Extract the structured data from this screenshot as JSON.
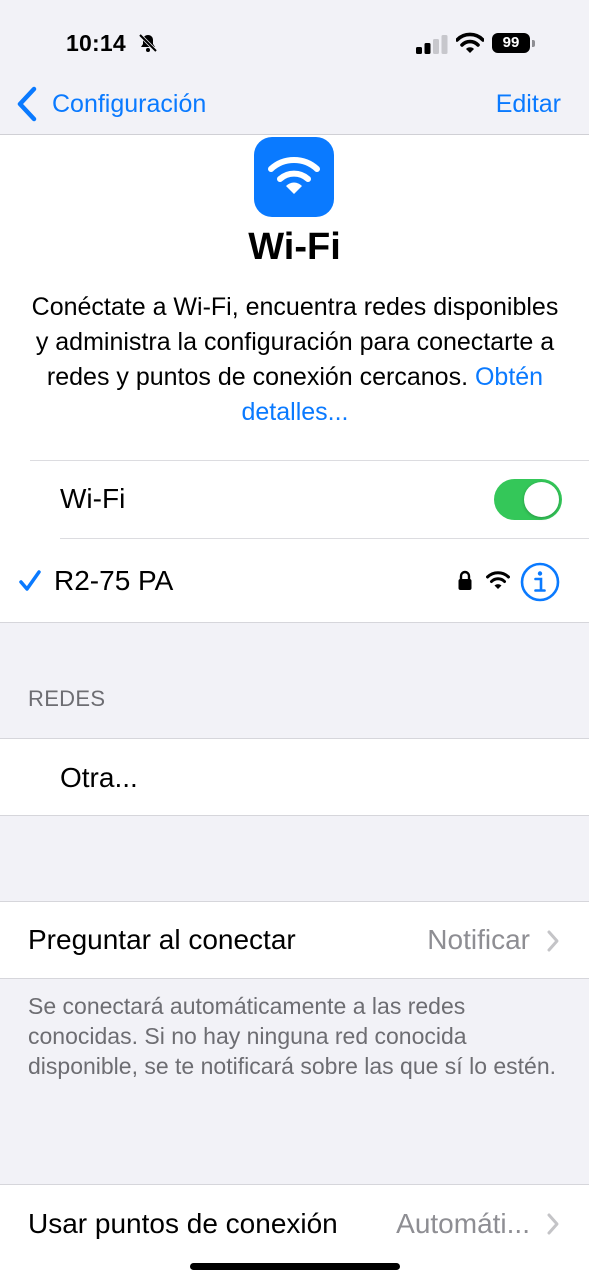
{
  "status_bar": {
    "time": "10:14",
    "battery": "99"
  },
  "nav": {
    "back_label": "Configuración",
    "edit_label": "Editar"
  },
  "header": {
    "title": "Wi-Fi",
    "description": "Conéctate a Wi-Fi, encuentra redes disponibles y administra la configuración para conectarte a redes y puntos de conexión cercanos.",
    "link": "Obtén detalles..."
  },
  "wifi_toggle": {
    "label": "Wi-Fi",
    "on": true
  },
  "connected_network": {
    "name": "R2-75 PA"
  },
  "networks_section": {
    "header": "REDES",
    "other_label": "Otra..."
  },
  "ask_to_join": {
    "label": "Preguntar al conectar",
    "value": "Notificar",
    "footer": "Se conectará automáticamente a las redes conocidas. Si no hay ninguna red conocida disponible, se te notificará sobre las que sí lo estén."
  },
  "hotspot": {
    "label": "Usar puntos de conexión",
    "value": "Automáti..."
  },
  "colors": {
    "accent": "#0a7aff",
    "toggle_on": "#34c759",
    "background": "#f2f2f7"
  }
}
